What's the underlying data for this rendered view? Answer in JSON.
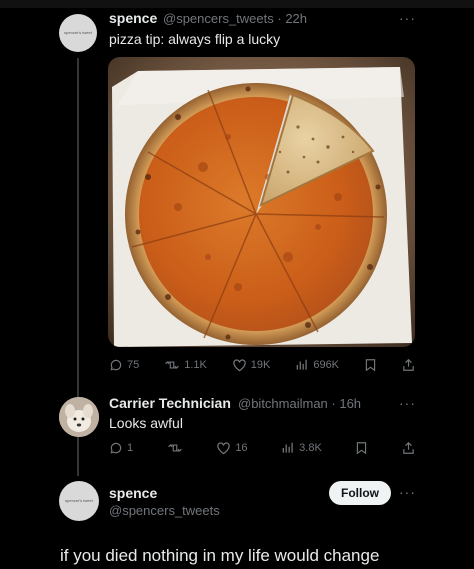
{
  "tweet": {
    "author_name": "spence",
    "author_handle": "@spencers_tweets",
    "time": "22h",
    "avatar_text": "spencer's tweet",
    "text": "pizza tip: always flip a lucky",
    "stats": {
      "replies": "75",
      "retweets": "1.1K",
      "likes": "19K",
      "views": "696K"
    }
  },
  "reply": {
    "author_name": "Carrier Technician",
    "author_handle": "@bitchmailman",
    "time": "16h",
    "text": "Looks awful",
    "stats": {
      "replies": "1",
      "likes": "16",
      "views": "3.8K"
    }
  },
  "quote": {
    "author_name": "spence",
    "author_handle": "@spencers_tweets",
    "avatar_text": "spencer's tweet",
    "follow_label": "Follow",
    "text": "if you died nothing in my life would change"
  },
  "icons": {
    "reply": "reply-icon",
    "retweet": "retweet-icon",
    "like": "heart-icon",
    "views": "analytics-icon",
    "bookmark": "bookmark-icon",
    "share": "share-icon",
    "more": "more-icon"
  },
  "colors": {
    "background": "#000000",
    "text": "#e7e9ea",
    "muted": "#71767b",
    "follow_bg": "#eff3f4"
  }
}
